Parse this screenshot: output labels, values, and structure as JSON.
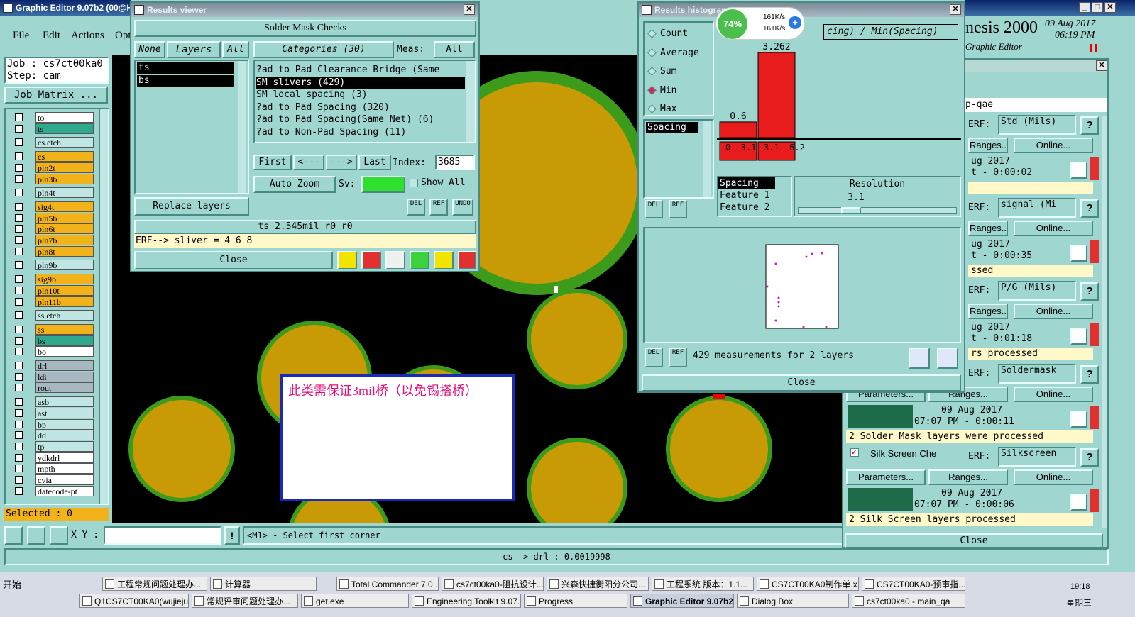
{
  "main": {
    "title": "Graphic Editor 9.07b2 (00@H",
    "menu": [
      "File",
      "Edit",
      "Actions",
      "Opt"
    ],
    "job_label": "Job : cs7ct00ka0",
    "step_label": "Step: cam",
    "job_matrix": "Job Matrix ...",
    "selected": "Selected : 0",
    "xy_label": "X Y :",
    "hint": "<M1> - Select first corner",
    "status_bottom": "cs -> drl : 0.0019998",
    "annotation": "此类需保证3mil桥（以免锡搭桥）",
    "brand": "nesis 2000",
    "brand_sub": "Graphic Editor",
    "brand_date": "09 Aug 2017",
    "brand_time": "06:19 PM"
  },
  "layers": [
    {
      "name": "to",
      "color": "#ffffff"
    },
    {
      "name": "ts",
      "color": "#2fa98e"
    },
    {
      "name": "cs.etch",
      "color": "#bfe6e2"
    },
    {
      "name": "cs",
      "color": "#f2b21a"
    },
    {
      "name": "pln2t",
      "color": "#f2b21a"
    },
    {
      "name": "pln3b",
      "color": "#f2b21a"
    },
    {
      "name": "pln4t",
      "color": "#bfe6e2"
    },
    {
      "name": "sig4t",
      "color": "#f2b21a"
    },
    {
      "name": "pln5b",
      "color": "#f2b21a"
    },
    {
      "name": "pln6t",
      "color": "#f2b21a"
    },
    {
      "name": "pln7b",
      "color": "#f2b21a"
    },
    {
      "name": "pln8t",
      "color": "#f2b21a"
    },
    {
      "name": "pln9b",
      "color": "#bfe6e2"
    },
    {
      "name": "sig9b",
      "color": "#f2b21a"
    },
    {
      "name": "pln10t",
      "color": "#f2b21a"
    },
    {
      "name": "pln11b",
      "color": "#f2b21a"
    },
    {
      "name": "ss.etch",
      "color": "#bfe6e2"
    },
    {
      "name": "ss",
      "color": "#f2b21a"
    },
    {
      "name": "bs",
      "color": "#2fa98e"
    },
    {
      "name": "bo",
      "color": "#ffffff"
    },
    {
      "name": "drl",
      "color": "#a8b8c0"
    },
    {
      "name": "ldi",
      "color": "#a8b8c0"
    },
    {
      "name": "rout",
      "color": "#a8b8c0"
    },
    {
      "name": "asb",
      "color": "#bfe6e2"
    },
    {
      "name": "ast",
      "color": "#bfe6e2"
    },
    {
      "name": "bp",
      "color": "#bfe6e2"
    },
    {
      "name": "dd",
      "color": "#bfe6e2"
    },
    {
      "name": "tp",
      "color": "#bfe6e2"
    },
    {
      "name": "ydkdrl",
      "color": "#ffffff"
    },
    {
      "name": "mpth",
      "color": "#ffffff"
    },
    {
      "name": "cvia",
      "color": "#ffffff"
    },
    {
      "name": "datecode-pt",
      "color": "#ffffff"
    }
  ],
  "results_viewer": {
    "title": "Results viewer",
    "header": "Solder Mask Checks",
    "none_btn": "None",
    "layers_btn": "Layers",
    "all_btn": "All",
    "layer_list": [
      "ts",
      "bs"
    ],
    "categories_btn": "Categories (30)",
    "meas_label": "Meas:",
    "meas_value": "All",
    "categories": [
      "?ad to Pad Clearance Bridge (Same",
      "SM slivers (429)",
      "SM local spacing (3)",
      "?ad to Pad Spacing (320)",
      "?ad to Pad Spacing(Same Net) (6)",
      "?ad to Non-Pad Spacing (11)"
    ],
    "first": "First",
    "prev": "<---",
    "next": "--->",
    "last": "Last",
    "index_label": "Index:",
    "index_value": "3685",
    "auto_zoom": "Auto Zoom",
    "sv_label": "Sv:",
    "show_all": "Show All",
    "replace_layers": "Replace layers",
    "del": "DEL",
    "ref": "REF",
    "undo": "UNDO",
    "status_line": "ts 2.545mil   r0   r0",
    "erf_line": "ERF--> sliver = 4 6 8",
    "close": "Close"
  },
  "histogram": {
    "title": "Results histogram",
    "options": [
      "Count",
      "Average",
      "Sum",
      "Min",
      "Max"
    ],
    "selected_option": "Min",
    "title_text": "cing) / Min(Spacing)",
    "spacing_item": "Spacing",
    "bars": [
      {
        "label": "0- 3.1",
        "value": 0.6
      },
      {
        "label": "3.1- 6.2",
        "value": 3.262
      }
    ],
    "bar_labels": [
      "0.6",
      "3.262"
    ],
    "features_list": [
      "Spacing",
      "Feature 1",
      "Feature 2"
    ],
    "resolution_label": "Resolution",
    "resolution_value": "3.1",
    "measurements": "429 measurements for 2 layers",
    "close": "Close",
    "net_pct": "74%",
    "net_up": "161K/s",
    "net_down": "161K/s"
  },
  "analysis": {
    "header": "p-qae",
    "items": [
      {
        "erf": "Std (Mils)",
        "date": "ug 2017",
        "time": "t - 0:00:02",
        "msg": ""
      },
      {
        "erf": "signal (Mi",
        "date": "ug 2017",
        "time": "t - 0:00:35",
        "msg": "ssed"
      },
      {
        "erf": "P/G (Mils)",
        "date": "ug 2017",
        "time": "t - 0:01:18",
        "msg": "rs processed"
      },
      {
        "erf": "Soldermask",
        "date": "09 Aug 2017",
        "time": "07:07 PM - 0:00:11",
        "msg": "2 Solder Mask layers were processed"
      },
      {
        "erf": "Silkscreen",
        "date": "09 Aug 2017",
        "time": "07:07 PM - 0:00:06",
        "msg": "2 Silk Screen layers processed"
      }
    ],
    "erf_label": "ERF:",
    "ranges": "Ranges...",
    "online": "Online...",
    "parameters": "Parameters...",
    "silk_check": "Silk Screen Che",
    "close": "Close"
  },
  "taskbar": {
    "start": "开始",
    "row1": [
      "工程常规问题处理办...",
      "计算器",
      "Total Commander 7.0 ...",
      "cs7ct00ka0-阻抗设计...",
      "兴森快捷衡阳分公司...",
      "工程系统  版本：1.1...",
      "CS7CT00KA0制作单.x...",
      "CS7CT00KA0-预审指..."
    ],
    "row2": [
      "Q1CS7CT00KA0(wujieju...",
      "常规评审问题处理办...",
      "get.exe",
      "Engineering Toolkit 9.07...",
      "Progress",
      "Graphic Editor 9.07b2...",
      "Dialog Box",
      "cs7ct00ka0 - main_qa"
    ],
    "clock": "19:18",
    "weekday": "星期三"
  }
}
